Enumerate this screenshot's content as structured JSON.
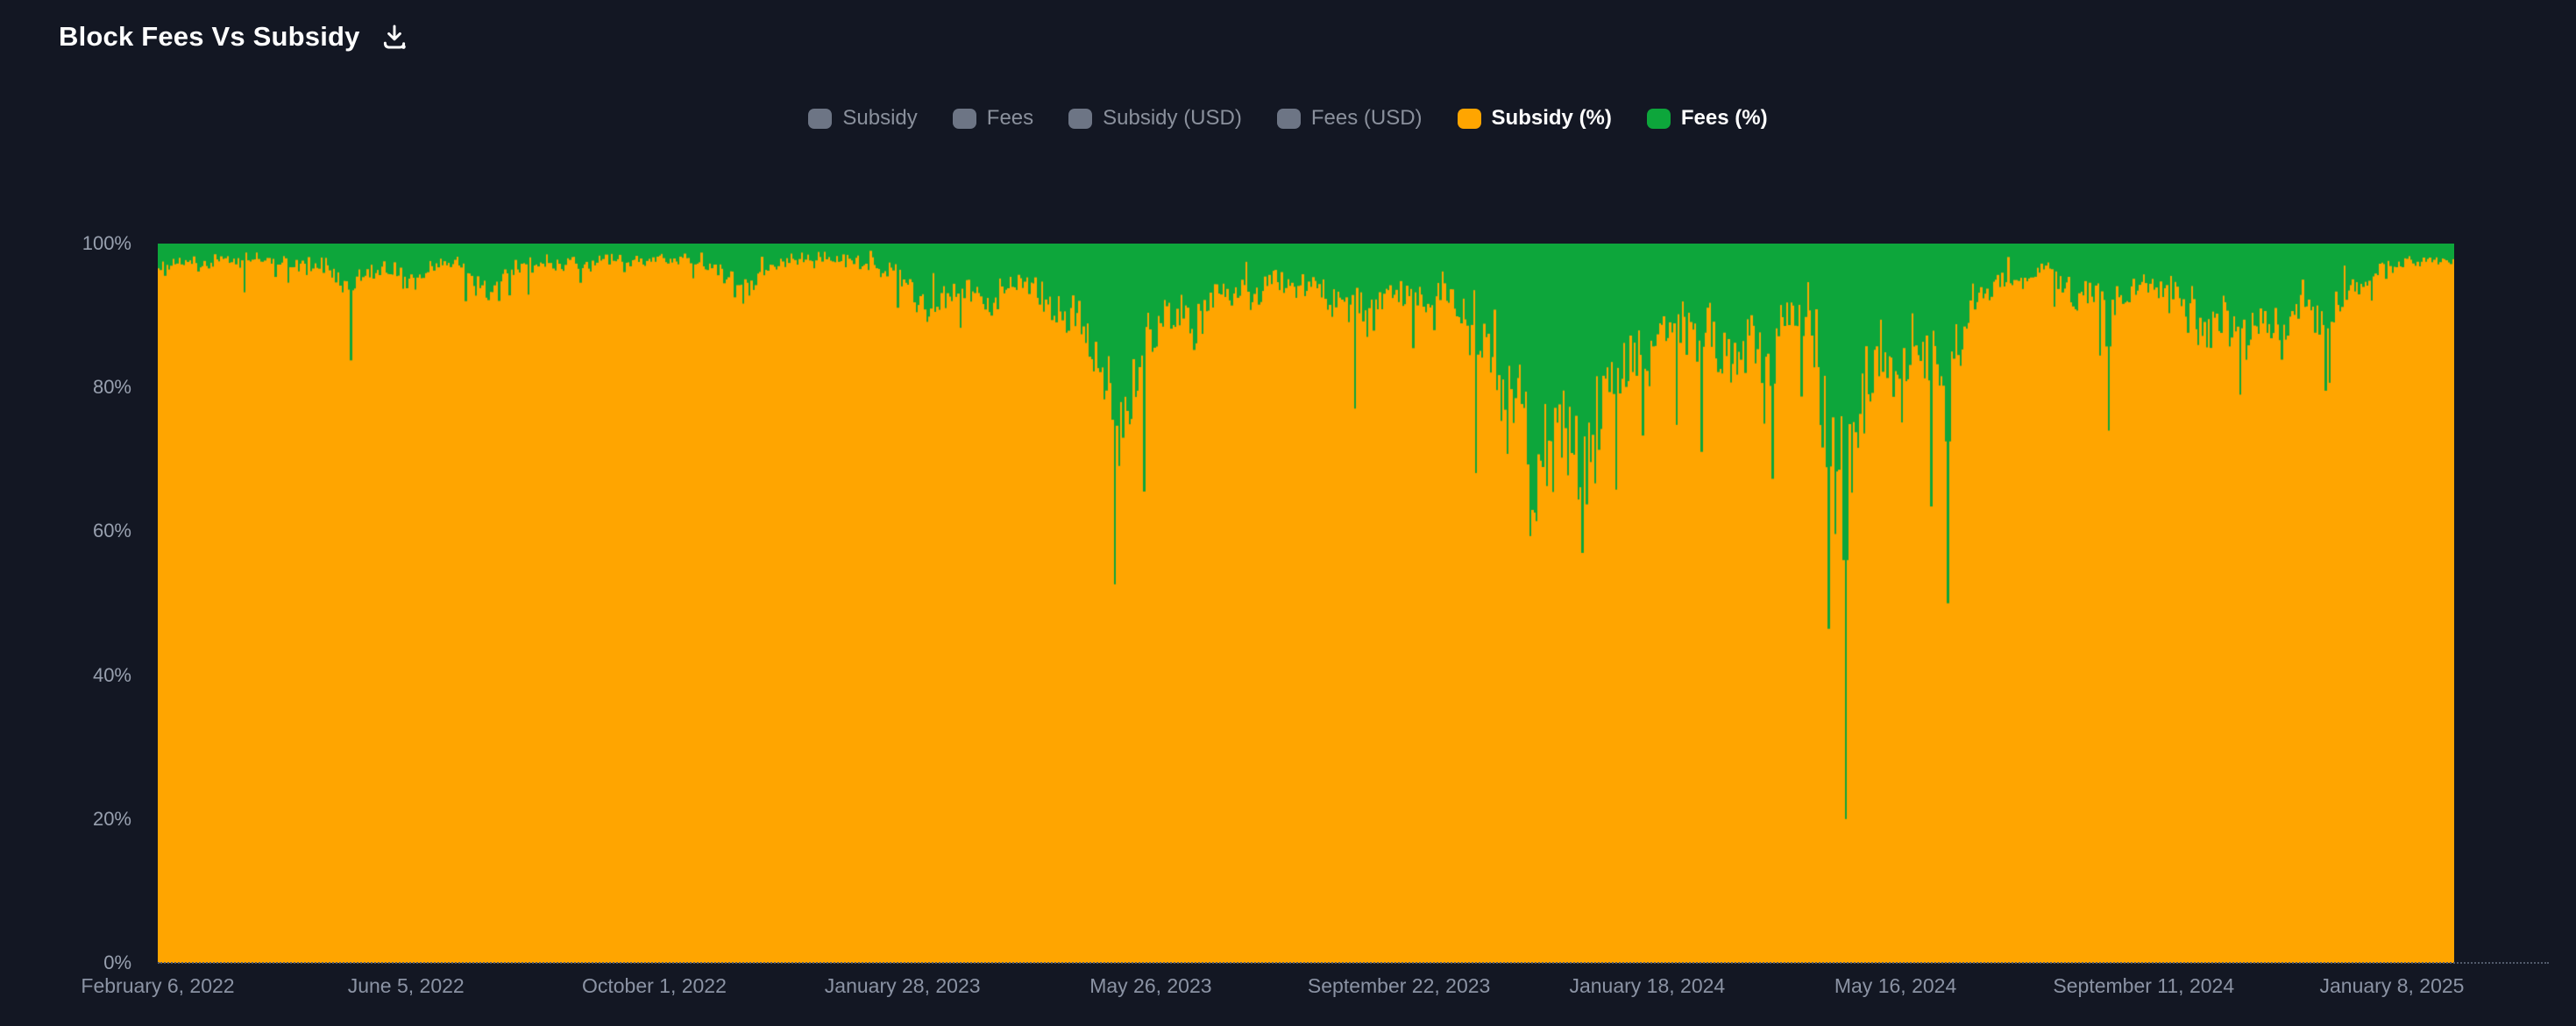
{
  "header": {
    "title": "Block Fees Vs Subsidy",
    "download_icon": "download-icon"
  },
  "colors": {
    "background": "#131723",
    "subsidy_orange": "#ffa500",
    "fees_green": "#0da63b",
    "legend_disabled_swatch": "#6d7585",
    "legend_disabled_text": "#8a909c",
    "axis_label": "#98a0af"
  },
  "legend": {
    "items": [
      {
        "label": "Subsidy",
        "color": "#6d7585",
        "active": false
      },
      {
        "label": "Fees",
        "color": "#6d7585",
        "active": false
      },
      {
        "label": "Subsidy (USD)",
        "color": "#6d7585",
        "active": false
      },
      {
        "label": "Fees (USD)",
        "color": "#6d7585",
        "active": false
      },
      {
        "label": "Subsidy (%)",
        "color": "#ffa500",
        "active": true
      },
      {
        "label": "Fees (%)",
        "color": "#0da63b",
        "active": true
      }
    ]
  },
  "chart_data": {
    "type": "area",
    "stacking": "percent",
    "title": "Block Fees Vs Subsidy",
    "grid": false,
    "legend_position": "top-center",
    "x_axis": {
      "start_date": "2022-02-06",
      "end_date": "2025-02-01",
      "sample_interval_days": 7,
      "tick_labels": [
        "February 6, 2022",
        "June 5, 2022",
        "October 1, 2022",
        "January 28, 2023",
        "May 26, 2023",
        "September 22, 2023",
        "January 18, 2024",
        "May 16, 2024",
        "September 11, 2024",
        "January 8, 2025"
      ]
    },
    "y_axis": {
      "min": 0,
      "max": 100,
      "tick_labels": [
        "0%",
        "20%",
        "40%",
        "60%",
        "80%",
        "100%"
      ],
      "unit": "%"
    },
    "series": [
      {
        "name": "Subsidy (%)",
        "color": "#ffa500",
        "values_are_100_minus_fees": true
      },
      {
        "name": "Fees (%)",
        "color": "#0da63b",
        "weekly_fees_pct": [
          3.5,
          2.6,
          2.3,
          2.8,
          2.2,
          2.5,
          2.1,
          2.6,
          2.4,
          2.8,
          3.3,
          2.6,
          4.2,
          6.2,
          4.6,
          3.4,
          3.8,
          5.8,
          4.0,
          3.2,
          2.8,
          3.0,
          5.5,
          6.8,
          4.2,
          3.0,
          2.7,
          3.2,
          2.5,
          2.9,
          2.6,
          2.3,
          2.8,
          2.4,
          2.2,
          2.6,
          2.1,
          2.4,
          2.7,
          5.5,
          7.2,
          4.6,
          3.4,
          2.8,
          2.4,
          2.2,
          2.0,
          2.3,
          2.6,
          3.2,
          4.0,
          5.0,
          7.5,
          9.5,
          7.0,
          5.8,
          6.5,
          8.5,
          7.0,
          5.5,
          6.5,
          8.0,
          10.5,
          9.0,
          15.0,
          44,
          26,
          18,
          13,
          11,
          9.5,
          12,
          8,
          7,
          6,
          8,
          5.5,
          5,
          6.5,
          5,
          7.5,
          9,
          8,
          10,
          7,
          6.5,
          9,
          7.5,
          6,
          8.5,
          12,
          16,
          26,
          18,
          30,
          30,
          26,
          43,
          30,
          20,
          17,
          14,
          19,
          11,
          10,
          14,
          11,
          16,
          18,
          13,
          21,
          11,
          9,
          12,
          25,
          80,
          28,
          20,
          14,
          24,
          12,
          18,
          50,
          14,
          8,
          6.5,
          5.5,
          4.5,
          5.5,
          4,
          5,
          8,
          6.5,
          26,
          8,
          6,
          5,
          7.5,
          6,
          9,
          13,
          10,
          21,
          13,
          9,
          14,
          10,
          8,
          11,
          8.5,
          6.5,
          5,
          4,
          3.2,
          2.6,
          2.2,
          2.5
        ]
      }
    ],
    "needles": [
      {
        "date": "2023-05-10",
        "week": 65,
        "fees_pct": 44
      },
      {
        "date": "2023-12-20",
        "week": 97,
        "fees_pct": 43
      },
      {
        "date": "2024-04-21",
        "week": 115,
        "fees_pct": 80
      },
      {
        "date": "2024-06-12",
        "week": 122,
        "fees_pct": 50
      },
      {
        "date": "2024-08-28",
        "week": 133,
        "fees_pct": 26
      },
      {
        "date": "2024-10-30",
        "week": 142,
        "fees_pct": 21
      }
    ]
  }
}
